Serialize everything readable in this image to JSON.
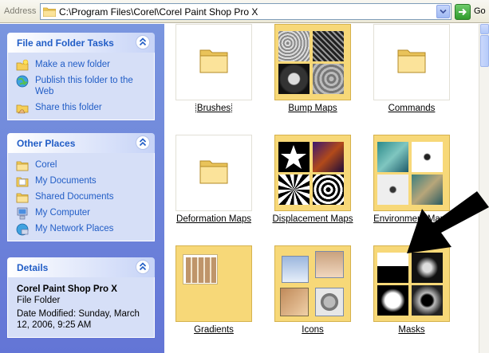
{
  "address_bar": {
    "label": "Address",
    "path": "C:\\Program Files\\Corel\\Corel Paint Shop Pro X",
    "go_label": "Go"
  },
  "tasks_panel": {
    "title": "File and Folder Tasks",
    "items": [
      {
        "label": "Make a new folder",
        "icon": "new-folder-icon"
      },
      {
        "label": "Publish this folder to the Web",
        "icon": "publish-web-icon"
      },
      {
        "label": "Share this folder",
        "icon": "share-folder-icon"
      }
    ]
  },
  "places_panel": {
    "title": "Other Places",
    "items": [
      {
        "label": "Corel",
        "icon": "folder-icon"
      },
      {
        "label": "My Documents",
        "icon": "my-documents-icon"
      },
      {
        "label": "Shared Documents",
        "icon": "folder-icon"
      },
      {
        "label": "My Computer",
        "icon": "my-computer-icon"
      },
      {
        "label": "My Network Places",
        "icon": "network-places-icon"
      }
    ]
  },
  "details_panel": {
    "title": "Details",
    "name": "Corel Paint Shop Pro X",
    "type": "File Folder",
    "modified": "Date Modified: Sunday, March 12, 2006, 9:25 AM"
  },
  "folders": [
    {
      "name": "Brushes",
      "kind": "empty"
    },
    {
      "name": "Bump Maps",
      "kind": "thumbs"
    },
    {
      "name": "Commands",
      "kind": "empty"
    },
    {
      "name": "Deformation Maps",
      "kind": "empty"
    },
    {
      "name": "Displacement Maps",
      "kind": "thumbs"
    },
    {
      "name": "Environment Maps",
      "kind": "thumbs"
    },
    {
      "name": "Gradients",
      "kind": "thumbs"
    },
    {
      "name": "Icons",
      "kind": "thumbs"
    },
    {
      "name": "Masks",
      "kind": "thumbs"
    }
  ],
  "colors": {
    "pane_blue": "#6375d6",
    "link_blue": "#215dc6",
    "folder_yellow": "#f7d878"
  }
}
